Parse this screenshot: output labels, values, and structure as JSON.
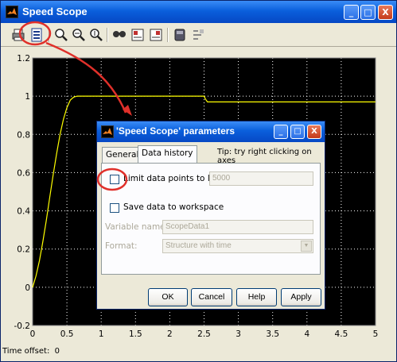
{
  "window": {
    "title": "Speed Scope",
    "minimize": "_",
    "maximize": "□",
    "close": "X"
  },
  "toolbar": {
    "tools": [
      "print-icon",
      "parameters-icon",
      "zoom-icon",
      "zoom-x-icon",
      "zoom-y-icon",
      "autoscale-icon",
      "save-axes-icon",
      "restore-axes-icon",
      "floating-scope-icon",
      "signal-selection-icon"
    ]
  },
  "status": {
    "time_offset_label": "Time offset:",
    "time_offset_value": "0"
  },
  "chart_data": {
    "type": "line",
    "xlim": [
      0,
      5
    ],
    "ylim": [
      -0.2,
      1.2
    ],
    "x_ticks": [
      "0",
      "0.5",
      "1",
      "1.5",
      "2",
      "2.5",
      "3",
      "3.5",
      "4",
      "4.5",
      "5"
    ],
    "y_ticks": [
      "-0.2",
      "0",
      "0.2",
      "0.4",
      "0.6",
      "0.8",
      "1",
      "1.2"
    ],
    "grid": true,
    "background": "#000000",
    "grid_color": "#ffffff",
    "line_color": "#ffff00",
    "series": [
      {
        "x": [
          0,
          0.05,
          0.1,
          0.15,
          0.2,
          0.25,
          0.3,
          0.35,
          0.4,
          0.45,
          0.5,
          0.55,
          0.6,
          0.65,
          0.7,
          2.5,
          2.52,
          2.55,
          5
        ],
        "y": [
          0,
          0.06,
          0.14,
          0.24,
          0.35,
          0.47,
          0.59,
          0.7,
          0.8,
          0.88,
          0.94,
          0.98,
          0.995,
          1.0,
          1.0,
          1.0,
          0.985,
          0.97,
          0.97
        ]
      }
    ]
  },
  "dialog": {
    "title": "'Speed Scope' parameters",
    "tabs": [
      "General",
      "Data history"
    ],
    "active_tab": "Data history",
    "tip": "Tip: try right clicking on axes",
    "limit_label": "Limit data points to last:",
    "limit_value": "5000",
    "save_label": "Save data to workspace",
    "varname_label": "Variable name:",
    "varname_value": "ScopeData1",
    "format_label": "Format:",
    "format_value": "Structure with time",
    "buttons": {
      "ok": "OK",
      "cancel": "Cancel",
      "help": "Help",
      "apply": "Apply"
    }
  },
  "annotation": {
    "color": "#e0302a"
  }
}
